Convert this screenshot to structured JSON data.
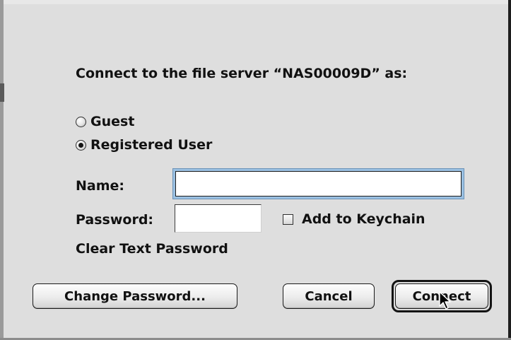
{
  "dialog": {
    "prompt": "Connect to the file server “NAS00009D” as:",
    "options": {
      "guest_label": "Guest",
      "registered_label": "Registered User",
      "selected": "Registered User"
    },
    "name_label": "Name:",
    "name_value": "",
    "password_label": "Password:",
    "password_value": "",
    "keychain_label": "Add to Keychain",
    "keychain_checked": false,
    "clear_text_note": "Clear Text Password",
    "buttons": {
      "change_password": "Change Password...",
      "cancel": "Cancel",
      "connect": "Connect"
    },
    "default_button": "Connect"
  },
  "colors": {
    "background": "#dedede",
    "focus_ring": "#9ac0e2"
  },
  "icons": {
    "pointer": "arrow-pointer-icon"
  }
}
